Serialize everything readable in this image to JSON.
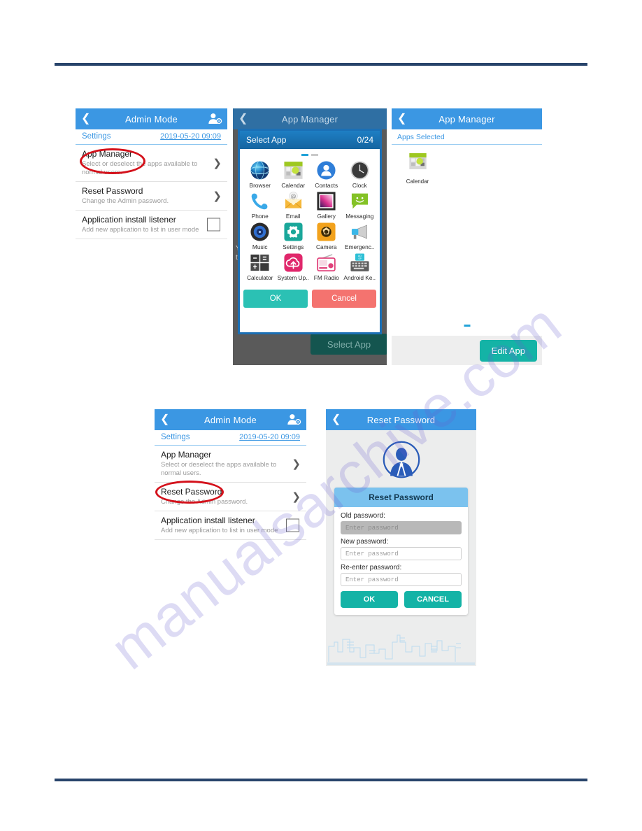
{
  "watermark": {
    "text": "manualsarchive.com"
  },
  "colors": {
    "header_blue": "#3b97e3",
    "teal": "#14b3a6",
    "cancel_red": "#f4736f",
    "annotation_red": "#d4111b",
    "rule_navy": "#28446b"
  },
  "screens": {
    "admin_mode_1": {
      "title": "Admin Mode",
      "back_icon": "chevron-left-icon",
      "user_icon": "user-settings-icon",
      "sub_left": "Settings",
      "sub_right": "2019-05-20 09:09",
      "rows": [
        {
          "title": "App Manager",
          "desc": "Select or deselect the apps available to normal users.",
          "accessory": "chevron"
        },
        {
          "title": "Reset Password",
          "desc": "Change the Admin password.",
          "accessory": "chevron"
        },
        {
          "title": "Application install listener",
          "desc": "Add new application to list in user mode",
          "accessory": "checkbox"
        }
      ],
      "annotation_target": "App Manager"
    },
    "app_manager_dialog": {
      "title": "App Manager",
      "back_icon": "chevron-left-icon",
      "ghost_lines": [
        "Y",
        "th"
      ],
      "ghost_button": "Select App",
      "dialog": {
        "title": "Select App",
        "counter": "0/24",
        "pages": 2,
        "active_page": 1,
        "apps": [
          {
            "label": "Browser",
            "icon": "globe-icon"
          },
          {
            "label": "Calendar",
            "icon": "calendar-icon"
          },
          {
            "label": "Contacts",
            "icon": "contacts-icon"
          },
          {
            "label": "Clock",
            "icon": "clock-icon"
          },
          {
            "label": "Phone",
            "icon": "phone-icon"
          },
          {
            "label": "Email",
            "icon": "email-icon"
          },
          {
            "label": "Gallery",
            "icon": "gallery-icon"
          },
          {
            "label": "Messaging",
            "icon": "messaging-icon"
          },
          {
            "label": "Music",
            "icon": "music-icon"
          },
          {
            "label": "Settings",
            "icon": "gear-icon"
          },
          {
            "label": "Camera",
            "icon": "camera-icon"
          },
          {
            "label": "Emergenc..",
            "icon": "megaphone-icon"
          },
          {
            "label": "Calculator",
            "icon": "calculator-icon"
          },
          {
            "label": "System Up..",
            "icon": "cloud-upload-icon"
          },
          {
            "label": "FM Radio",
            "icon": "radio-icon"
          },
          {
            "label": "Android Ke..",
            "icon": "keyboard-icon"
          }
        ],
        "ok_label": "OK",
        "cancel_label": "Cancel"
      }
    },
    "apps_selected": {
      "title": "App Manager",
      "back_icon": "chevron-left-icon",
      "section_label": "Apps Selected",
      "selected_apps": [
        {
          "label": "Calendar",
          "icon": "calendar-icon"
        }
      ],
      "edit_app_label": "Edit App"
    },
    "admin_mode_2": {
      "title": "Admin Mode",
      "back_icon": "chevron-left-icon",
      "user_icon": "user-settings-icon",
      "sub_left": "Settings",
      "sub_right": "2019-05-20 09:09",
      "rows": [
        {
          "title": "App Manager",
          "desc": "Select or deselect the apps available to normal users.",
          "accessory": "chevron"
        },
        {
          "title": "Reset Password",
          "desc": "Change the Admin password.",
          "accessory": "chevron"
        },
        {
          "title": "Application install listener",
          "desc": "Add new application to list in user mode",
          "accessory": "checkbox"
        }
      ],
      "annotation_target": "Reset Password"
    },
    "reset_password": {
      "title": "Reset Password",
      "back_icon": "chevron-left-icon",
      "avatar_icon": "admin-avatar-icon",
      "card_title": "Reset Password",
      "fields": [
        {
          "label": "Old password:",
          "placeholder": "Enter  password",
          "value": "",
          "active": true
        },
        {
          "label": "New password:",
          "placeholder": "Enter  password",
          "value": "",
          "active": false
        },
        {
          "label": "Re-enter password:",
          "placeholder": "Enter  password",
          "value": "",
          "active": false
        }
      ],
      "ok_label": "OK",
      "cancel_label": "CANCEL"
    }
  }
}
